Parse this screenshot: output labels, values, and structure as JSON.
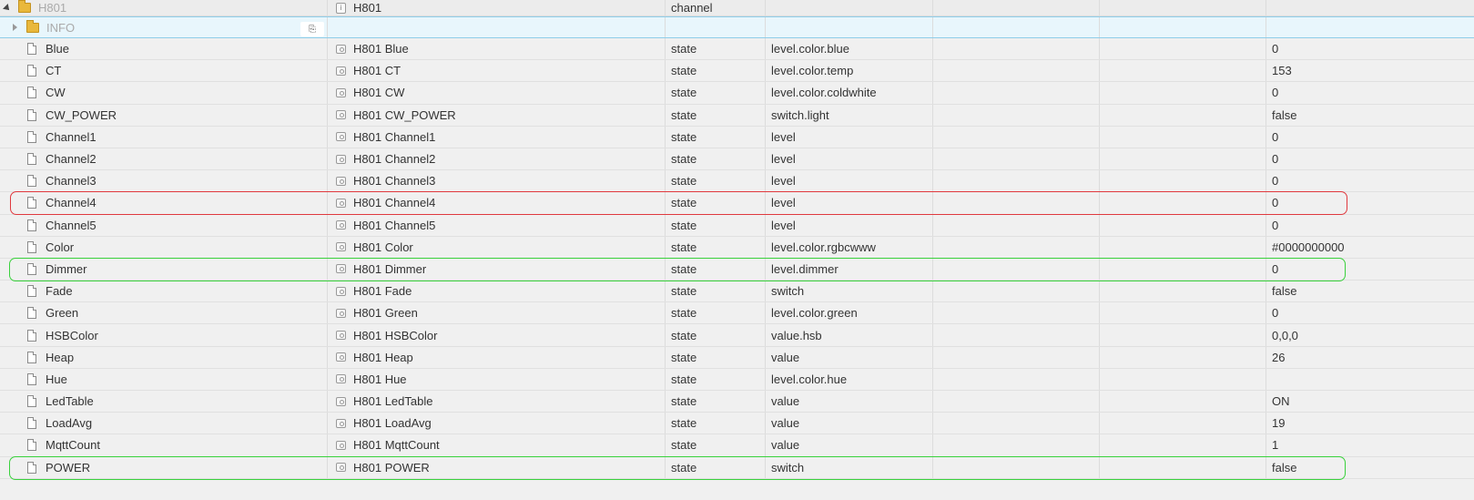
{
  "header": {
    "name": "H801",
    "object_name": "H801",
    "type": "channel"
  },
  "info_folder": {
    "name": "INFO",
    "copy_icon": "copy-icon"
  },
  "rows": [
    {
      "id": "Blue",
      "name": "H801 Blue",
      "type": "state",
      "role": "level.color.blue",
      "value": "0"
    },
    {
      "id": "CT",
      "name": "H801 CT",
      "type": "state",
      "role": "level.color.temp",
      "value": "153"
    },
    {
      "id": "CW",
      "name": "H801 CW",
      "type": "state",
      "role": "level.color.coldwhite",
      "value": "0"
    },
    {
      "id": "CW_POWER",
      "name": "H801 CW_POWER",
      "type": "state",
      "role": "switch.light",
      "value": "false"
    },
    {
      "id": "Channel1",
      "name": "H801 Channel1",
      "type": "state",
      "role": "level",
      "value": "0"
    },
    {
      "id": "Channel2",
      "name": "H801 Channel2",
      "type": "state",
      "role": "level",
      "value": "0"
    },
    {
      "id": "Channel3",
      "name": "H801 Channel3",
      "type": "state",
      "role": "level",
      "value": "0"
    },
    {
      "id": "Channel4",
      "name": "H801 Channel4",
      "type": "state",
      "role": "level",
      "value": "0"
    },
    {
      "id": "Channel5",
      "name": "H801 Channel5",
      "type": "state",
      "role": "level",
      "value": "0"
    },
    {
      "id": "Color",
      "name": "H801 Color",
      "type": "state",
      "role": "level.color.rgbcwww",
      "value": "#0000000000"
    },
    {
      "id": "Dimmer",
      "name": "H801 Dimmer",
      "type": "state",
      "role": "level.dimmer",
      "value": "0"
    },
    {
      "id": "Fade",
      "name": "H801 Fade",
      "type": "state",
      "role": "switch",
      "value": "false"
    },
    {
      "id": "Green",
      "name": "H801 Green",
      "type": "state",
      "role": "level.color.green",
      "value": "0"
    },
    {
      "id": "HSBColor",
      "name": "H801 HSBColor",
      "type": "state",
      "role": "value.hsb",
      "value": "0,0,0"
    },
    {
      "id": "Heap",
      "name": "H801 Heap",
      "type": "state",
      "role": "value",
      "value": "26"
    },
    {
      "id": "Hue",
      "name": "H801 Hue",
      "type": "state",
      "role": "level.color.hue",
      "value": ""
    },
    {
      "id": "LedTable",
      "name": "H801 LedTable",
      "type": "state",
      "role": "value",
      "value": "ON"
    },
    {
      "id": "LoadAvg",
      "name": "H801 LoadAvg",
      "type": "state",
      "role": "value",
      "value": "19"
    },
    {
      "id": "MqttCount",
      "name": "H801 MqttCount",
      "type": "state",
      "role": "value",
      "value": "1"
    },
    {
      "id": "POWER",
      "name": "H801 POWER",
      "type": "state",
      "role": "switch",
      "value": "false"
    }
  ],
  "highlights": [
    {
      "row": "Channel4",
      "color": "red"
    },
    {
      "row": "Dimmer",
      "color": "green"
    },
    {
      "row": "POWER",
      "color": "green"
    }
  ]
}
